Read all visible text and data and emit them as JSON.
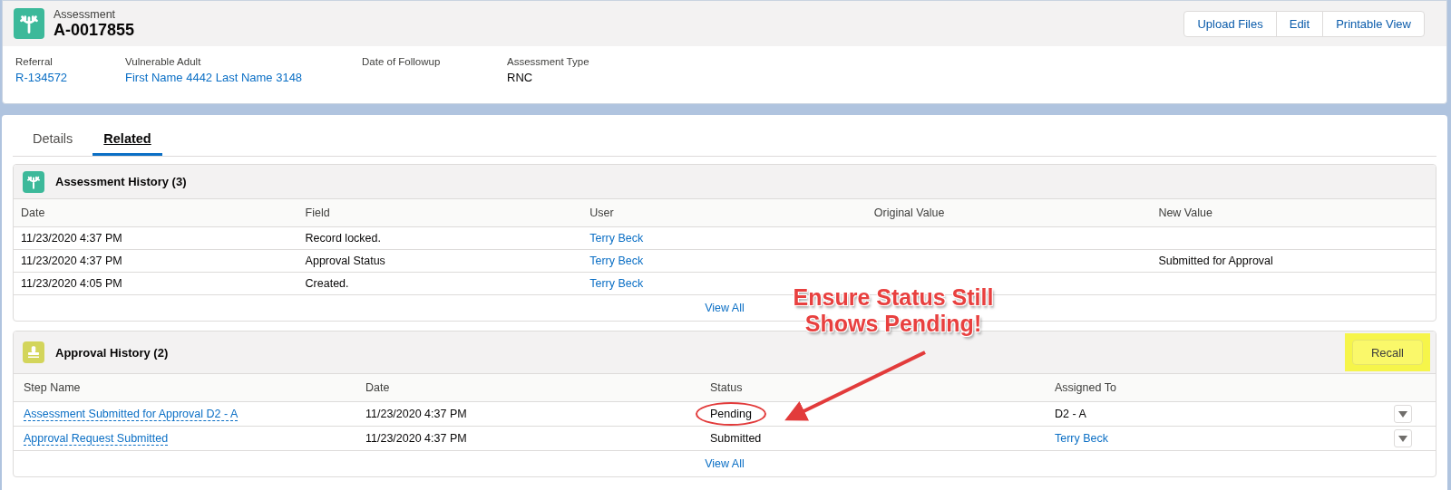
{
  "record": {
    "object_label": "Assessment",
    "title": "A-0017855",
    "actions": [
      {
        "label": "Upload Files"
      },
      {
        "label": "Edit"
      },
      {
        "label": "Printable View"
      }
    ],
    "fields": [
      {
        "label": "Referral",
        "value": "R-134572",
        "kind": "link"
      },
      {
        "label": "Vulnerable Adult",
        "value": "First Name 4442 Last Name 3148",
        "kind": "link"
      },
      {
        "label": "Date of Followup"
      },
      {
        "label": "Assessment Type",
        "value": "RNC",
        "kind": "text"
      }
    ]
  },
  "tabs": [
    {
      "label": "Details",
      "selected": false
    },
    {
      "label": "Related",
      "selected": true
    }
  ],
  "related_lists": [
    {
      "title": "Assessment History (3)",
      "kind": "assessment",
      "columns": [
        "Date",
        "Field",
        "User",
        "Original Value",
        "New Value"
      ],
      "rows": [
        {
          "cells": [
            {
              "text": "11/23/2020 4:37 PM",
              "kind": "text"
            },
            {
              "text": "Record locked.",
              "kind": "text"
            },
            {
              "text": "Terry Beck",
              "kind": "link"
            },
            null,
            null
          ]
        },
        {
          "cells": [
            {
              "text": "11/23/2020 4:37 PM",
              "kind": "text"
            },
            {
              "text": "Approval Status",
              "kind": "text"
            },
            {
              "text": "Terry Beck",
              "kind": "link"
            },
            null,
            {
              "text": "Submitted for Approval",
              "kind": "text"
            }
          ]
        },
        {
          "cells": [
            {
              "text": "11/23/2020 4:05 PM",
              "kind": "text"
            },
            {
              "text": "Created.",
              "kind": "text"
            },
            {
              "text": "Terry Beck",
              "kind": "link"
            },
            null,
            null
          ]
        }
      ],
      "footer_link": "View All"
    },
    {
      "title": "Approval History (2)",
      "kind": "approval",
      "header_action": {
        "label": "Recall",
        "highlighted": true
      },
      "row_menu": true,
      "columns": [
        "Step Name",
        "Date",
        "Status",
        "Assigned To"
      ],
      "rows": [
        {
          "cells": [
            {
              "text": "Assessment Submitted for Approval D2 - A",
              "kind": "record_link"
            },
            {
              "text": "11/23/2020 4:37 PM",
              "kind": "text"
            },
            {
              "text": "Pending",
              "kind": "text",
              "circled": true
            },
            {
              "text": "D2 - A",
              "kind": "text"
            }
          ]
        },
        {
          "cells": [
            {
              "text": "Approval Request Submitted",
              "kind": "record_link"
            },
            {
              "text": "11/23/2020 4:37 PM",
              "kind": "text"
            },
            {
              "text": "Submitted",
              "kind": "text"
            },
            {
              "text": "Terry Beck",
              "kind": "link"
            }
          ]
        }
      ],
      "footer_link": "View All"
    }
  ],
  "callout": {
    "lines": [
      "Ensure Status Still",
      "Shows Pending!"
    ]
  }
}
